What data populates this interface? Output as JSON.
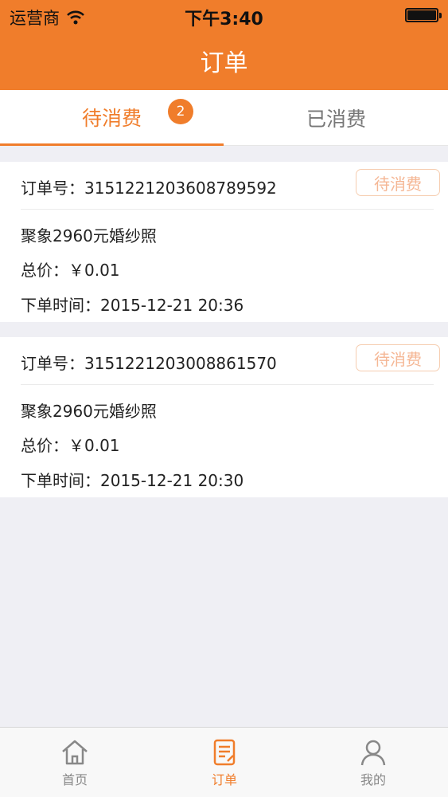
{
  "status_bar": {
    "carrier": "运营商",
    "time": "下午3:40"
  },
  "nav": {
    "title": "订单"
  },
  "tabs": [
    {
      "label": "待消费",
      "badge": "2",
      "active": true
    },
    {
      "label": "已消费",
      "active": false
    }
  ],
  "orders": [
    {
      "order_no": "订单号：3151221203608789592",
      "status": "待消费",
      "product": "聚象2960元婚纱照",
      "price": "总价：￥0.01",
      "time": "下单时间：2015-12-21 20:36"
    },
    {
      "order_no": "订单号：3151221203008861570",
      "status": "待消费",
      "product": "聚象2960元婚纱照",
      "price": "总价：￥0.01",
      "time": "下单时间：2015-12-21 20:30"
    }
  ],
  "tabbar": [
    {
      "label": "首页",
      "icon": "home-icon",
      "active": false
    },
    {
      "label": "订单",
      "icon": "order-icon",
      "active": true
    },
    {
      "label": "我的",
      "icon": "user-icon",
      "active": false
    }
  ],
  "colors": {
    "accent": "#f07d2b",
    "background": "#efeff4",
    "status_text": "#f5b795"
  }
}
